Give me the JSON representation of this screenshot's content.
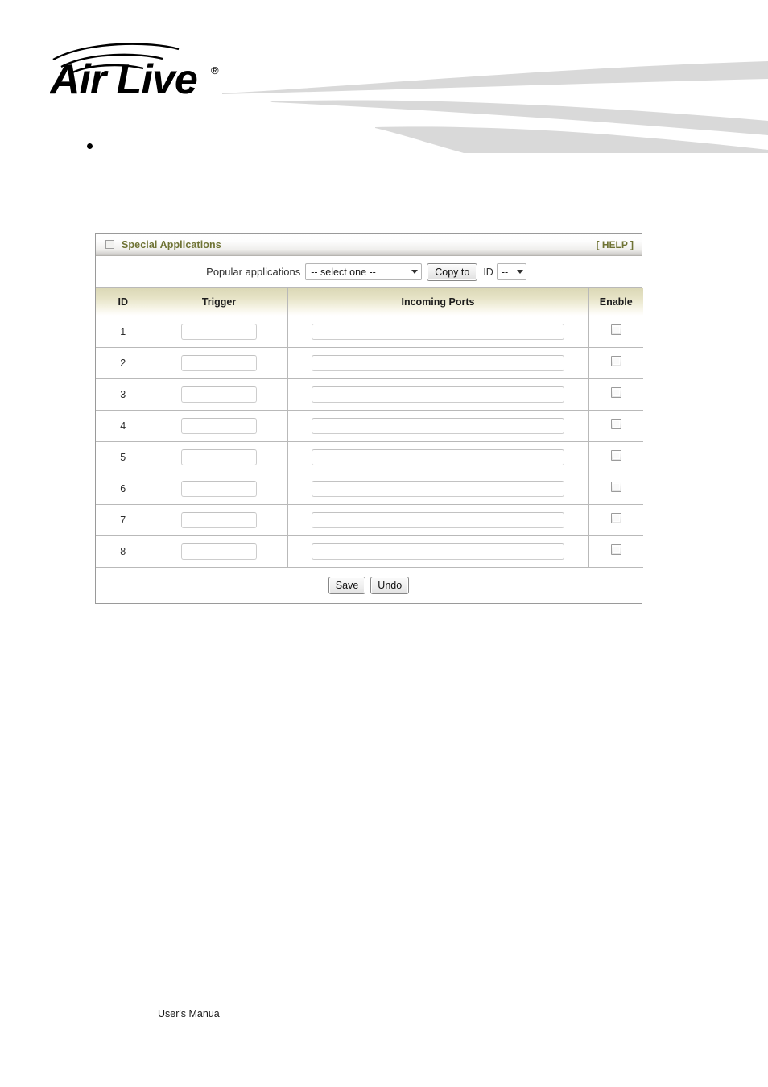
{
  "header": {
    "brand_name": "Air Live",
    "brand_trademark": "®",
    "logo_icon": "airlive-wireless-logo",
    "swoosh_icon": "header-swoosh-graphic",
    "swoosh_color": "#d9d9d9"
  },
  "body": {
    "bullet_item_text": ""
  },
  "panel": {
    "box_icon": "collapse-box-icon",
    "title": "Special Applications",
    "help_label": "[ HELP ]",
    "title_color": "#6f7334",
    "popular": {
      "label": "Popular applications",
      "app_select_value": "-- select one --",
      "copy_to_label": "Copy to",
      "id_label": "ID",
      "id_select_value": "--",
      "caret_icon": "chevron-down-icon"
    },
    "table": {
      "columns": [
        "ID",
        "Trigger",
        "Incoming Ports",
        "Enable"
      ],
      "rows": [
        {
          "id": "1",
          "trigger": "",
          "incoming_ports": "",
          "enable": false
        },
        {
          "id": "2",
          "trigger": "",
          "incoming_ports": "",
          "enable": false
        },
        {
          "id": "3",
          "trigger": "",
          "incoming_ports": "",
          "enable": false
        },
        {
          "id": "4",
          "trigger": "",
          "incoming_ports": "",
          "enable": false
        },
        {
          "id": "5",
          "trigger": "",
          "incoming_ports": "",
          "enable": false
        },
        {
          "id": "6",
          "trigger": "",
          "incoming_ports": "",
          "enable": false
        },
        {
          "id": "7",
          "trigger": "",
          "incoming_ports": "",
          "enable": false
        },
        {
          "id": "8",
          "trigger": "",
          "incoming_ports": "",
          "enable": false
        }
      ]
    },
    "actions": {
      "save_label": "Save",
      "undo_label": "Undo"
    }
  },
  "footer": {
    "text": "User's Manua"
  }
}
